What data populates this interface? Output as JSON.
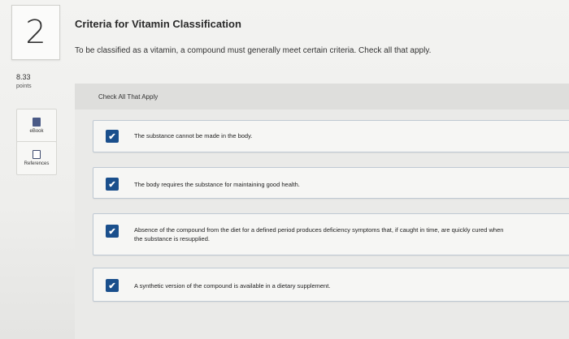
{
  "question": {
    "number": "2",
    "title": "Criteria for Vitamin Classification",
    "prompt": "To be classified as a vitamin, a compound must generally meet certain criteria. Check all that apply."
  },
  "score": {
    "points_value": "8.33",
    "points_label": "points"
  },
  "tools": [
    {
      "label": "eBook",
      "icon": "ebook-icon"
    },
    {
      "label": "References",
      "icon": "references-icon"
    }
  ],
  "answer_area": {
    "header": "Check All That Apply",
    "options": [
      {
        "checked": true,
        "text": "The substance cannot be made in the body."
      },
      {
        "checked": true,
        "text": "The body requires the substance for maintaining good health."
      },
      {
        "checked": true,
        "text": "Absence of the compound from the diet for a defined period produces deficiency symptoms that, if caught in time, are quickly cured when",
        "text2": "the substance is resupplied."
      },
      {
        "checked": true,
        "text": "A synthetic version of the compound is available in a dietary supplement."
      }
    ]
  },
  "colors": {
    "checkbox": "#1a4f8c",
    "option_border": "#bfc9d3"
  }
}
